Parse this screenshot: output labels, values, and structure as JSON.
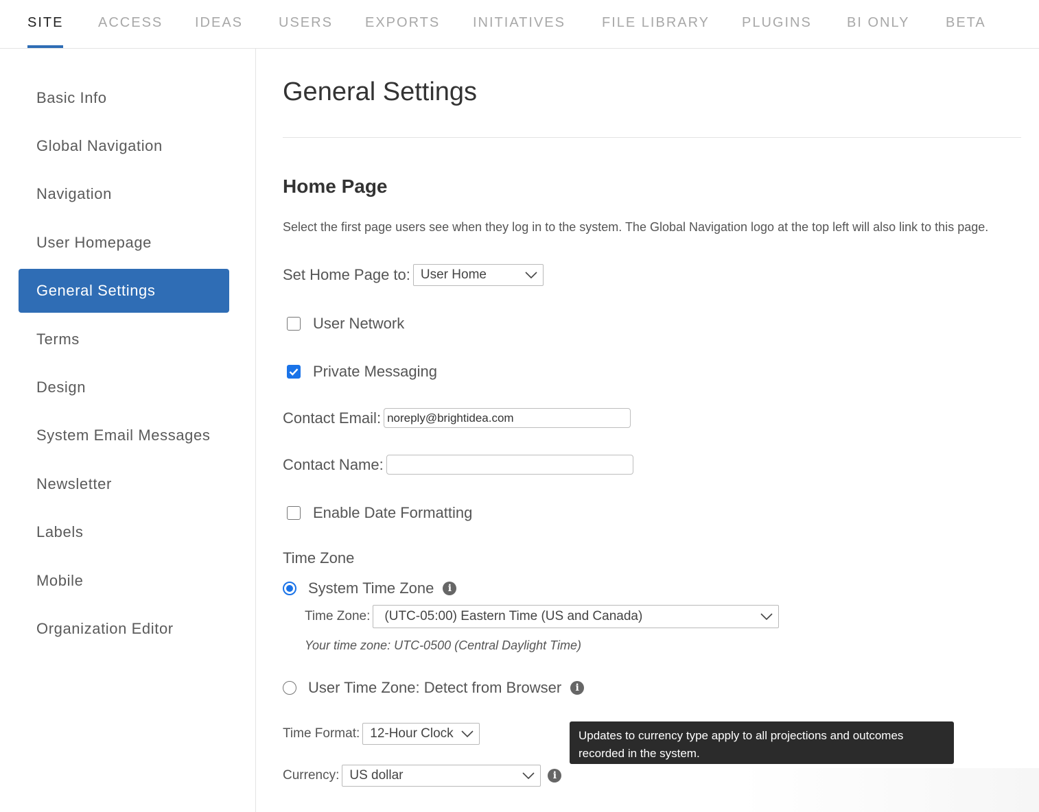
{
  "tabs": [
    {
      "label": "SITE",
      "active": true
    },
    {
      "label": "ACCESS"
    },
    {
      "label": "IDEAS"
    },
    {
      "label": "USERS"
    },
    {
      "label": "EXPORTS"
    },
    {
      "label": "INITIATIVES"
    },
    {
      "label": "FILE LIBRARY"
    },
    {
      "label": "PLUGINS"
    },
    {
      "label": "BI ONLY"
    },
    {
      "label": "BETA"
    }
  ],
  "sidebar": {
    "items": [
      {
        "label": "Basic Info"
      },
      {
        "label": "Global Navigation"
      },
      {
        "label": "Navigation"
      },
      {
        "label": "User Homepage"
      },
      {
        "label": "General Settings",
        "active": true
      },
      {
        "label": "Terms"
      },
      {
        "label": "Design"
      },
      {
        "label": "System Email Messages"
      },
      {
        "label": "Newsletter"
      },
      {
        "label": "Labels"
      },
      {
        "label": "Mobile"
      },
      {
        "label": "Organization Editor"
      }
    ]
  },
  "main": {
    "title": "General Settings",
    "section_title": "Home Page",
    "description": "Select the first page users see when they log in to the system. The Global Navigation logo at the top left will also link to this page.",
    "home_page_label": "Set Home Page to:",
    "home_page_value": "User Home",
    "user_network_label": "User Network",
    "user_network_checked": false,
    "private_messaging_label": "Private Messaging",
    "private_messaging_checked": true,
    "contact_email_label": "Contact Email:",
    "contact_email_value": "noreply@brightidea.com",
    "contact_name_label": "Contact Name:",
    "contact_name_value": "",
    "date_formatting_label": "Enable Date Formatting",
    "date_formatting_checked": false,
    "time_zone_heading": "Time Zone",
    "system_tz_label": "System Time Zone",
    "tz_select_label": "Time Zone:",
    "tz_select_value": "(UTC-05:00) Eastern Time (US and Canada)",
    "your_tz_note": "Your time zone: UTC-0500 (Central Daylight Time)",
    "user_tz_label": "User Time Zone: Detect from Browser",
    "time_format_label": "Time Format:",
    "time_format_value": "12-Hour Clock",
    "currency_label": "Currency:",
    "currency_value": "US dollar",
    "tooltip_text": "Updates to currency type apply to all projections and outcomes recorded in the system."
  },
  "colors": {
    "accent": "#2f6db5",
    "checkbox_blue": "#1a73e8",
    "tooltip_bg": "#2b2b2b"
  }
}
